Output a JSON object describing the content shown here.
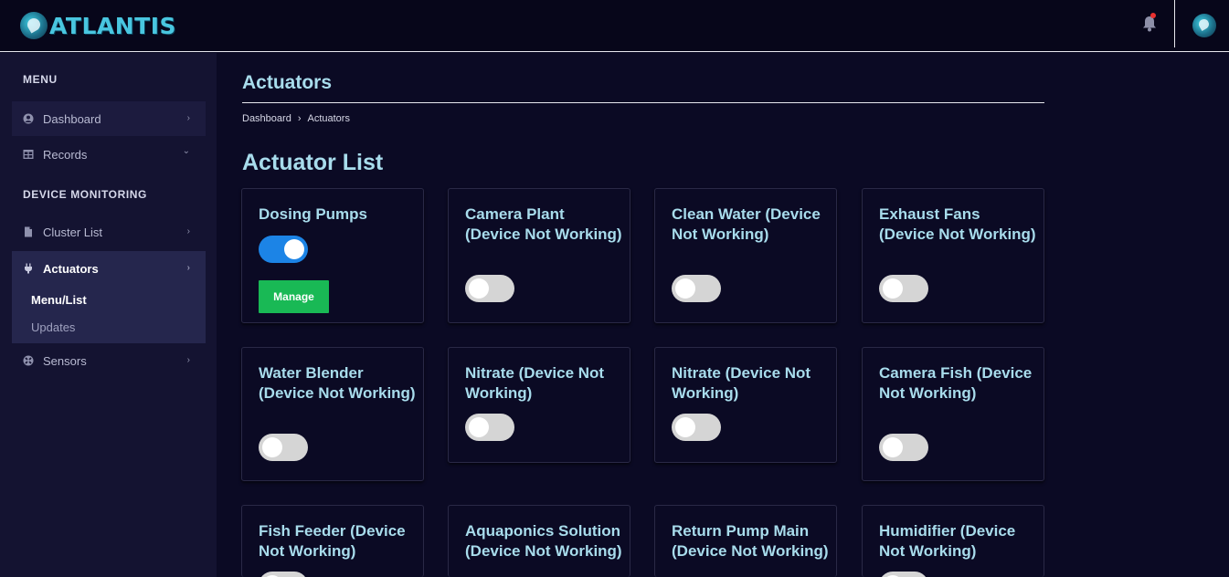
{
  "brand": {
    "name": "ATLANTIS"
  },
  "sidebar": {
    "menu_heading": "MENU",
    "device_heading": "DEVICE MONITORING",
    "items": [
      {
        "label": "Dashboard",
        "icon": "user-circle-icon",
        "chevron": "›"
      },
      {
        "label": "Records",
        "icon": "table-icon",
        "chevron": "⌄"
      },
      {
        "label": "Cluster List",
        "icon": "file-icon",
        "chevron": "›"
      },
      {
        "label": "Actuators",
        "icon": "plug-icon",
        "chevron": "›"
      },
      {
        "label": "Sensors",
        "icon": "sensor-icon",
        "chevron": "›"
      }
    ],
    "actuators_sub": [
      {
        "label": "Menu/List"
      },
      {
        "label": "Updates"
      }
    ]
  },
  "page": {
    "title": "Actuators",
    "breadcrumb": [
      "Dashboard",
      "Actuators"
    ],
    "breadcrumb_separator": "›",
    "section_title": "Actuator List"
  },
  "cards": [
    {
      "title": "Dosing Pumps",
      "on": true,
      "button": "Manage"
    },
    {
      "title": "Camera Plant (Device Not Working)",
      "on": false
    },
    {
      "title": "Clean Water (Device Not Working)",
      "on": false
    },
    {
      "title": "Exhaust Fans (Device Not Working)",
      "on": false
    },
    {
      "title": "Water Blender (Device Not Working)",
      "on": false
    },
    {
      "title": "Nitrate (Device Not Working)",
      "on": false
    },
    {
      "title": "Nitrate (Device Not Working)",
      "on": false
    },
    {
      "title": "Camera Fish (Device Not Working)",
      "on": false
    },
    {
      "title": "Fish Feeder (Device Not Working)",
      "on": false
    },
    {
      "title": "Aquaponics Solution (Device Not Working)",
      "on": false
    },
    {
      "title": "Return Pump Main (Device Not Working)",
      "on": false
    },
    {
      "title": "Humidifier (Device Not Working)",
      "on": false
    }
  ],
  "colors": {
    "background": "#0b0a24",
    "accent_text": "#a8dcec",
    "toggle_on": "#1c84e6",
    "button_green": "#19b955"
  }
}
